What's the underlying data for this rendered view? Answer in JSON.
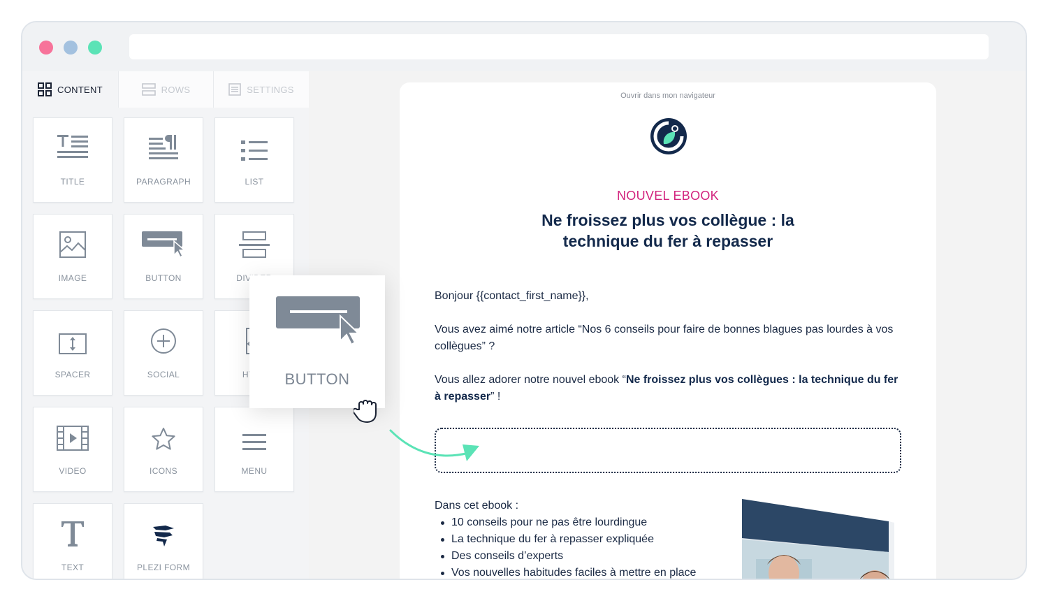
{
  "sidebar": {
    "tabs": [
      {
        "label": "CONTENT",
        "icon": "grid-icon",
        "active": true
      },
      {
        "label": "ROWS",
        "icon": "rows-icon",
        "active": false
      },
      {
        "label": "SETTINGS",
        "icon": "settings-icon",
        "active": false
      }
    ],
    "blocks": [
      {
        "label": "TITLE",
        "icon": "title-icon"
      },
      {
        "label": "PARAGRAPH",
        "icon": "paragraph-icon"
      },
      {
        "label": "LIST",
        "icon": "list-icon"
      },
      {
        "label": "IMAGE",
        "icon": "image-icon"
      },
      {
        "label": "BUTTON",
        "icon": "button-icon"
      },
      {
        "label": "DIVIDER",
        "icon": "divider-icon"
      },
      {
        "label": "SPACER",
        "icon": "spacer-icon"
      },
      {
        "label": "SOCIAL",
        "icon": "social-icon"
      },
      {
        "label": "HTML",
        "icon": "html-icon"
      },
      {
        "label": "VIDEO",
        "icon": "video-icon"
      },
      {
        "label": "ICONS",
        "icon": "star-icon"
      },
      {
        "label": "MENU",
        "icon": "menu-icon"
      },
      {
        "label": "TEXT",
        "icon": "text-icon"
      },
      {
        "label": "PLEZI FORM",
        "icon": "plezi-form-icon"
      }
    ]
  },
  "drag": {
    "label": "BUTTON",
    "icon": "button-icon",
    "cursor": "grab-hand-icon"
  },
  "email": {
    "open_link": "Ouvrir dans mon navigateur",
    "kicker": "NOUVEL EBOOK",
    "headline_line1": "Ne froissez plus vos collègue : la",
    "headline_line2": "technique du fer à repasser",
    "greeting": "Bonjour {{contact_first_name}},",
    "para1": "Vous avez aimé notre article “Nos 6 conseils pour faire de bonnes blagues pas lourdes à vos collègues” ?",
    "para2_prefix": "Vous allez adorer notre nouvel ebook “",
    "para2_bold": "Ne froissez plus vos collègues : la technique du fer à repasser",
    "para2_suffix": "” !",
    "list_intro": "Dans cet ebook :",
    "list_items": [
      "10 conseils pour ne pas être lourdingue",
      "La technique du fer à repasser expliquée",
      "Des conseils d’experts",
      "Vos nouvelles habitudes faciles à mettre en place"
    ]
  },
  "colors": {
    "accent_pink": "#d2237e",
    "navy": "#13294b",
    "teal": "#5be3b6"
  }
}
